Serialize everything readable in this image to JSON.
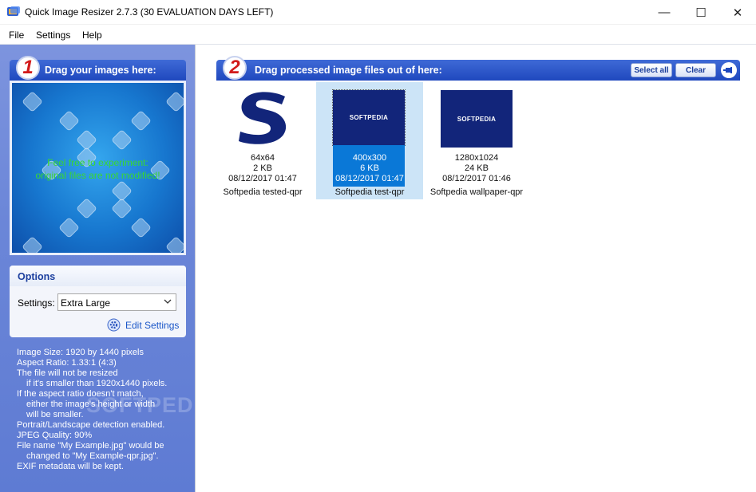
{
  "window": {
    "title": "Quick Image Resizer 2.7.3 (30 EVALUATION DAYS LEFT)",
    "minimize": "—",
    "maximize": "☐",
    "close": "✕"
  },
  "menu": [
    "File",
    "Settings",
    "Help"
  ],
  "left_panel": {
    "badge": "1",
    "header": "Drag your images here:",
    "drop_hint_line1": "Feel free to experiment:",
    "drop_hint_line2": "original files are not modified!"
  },
  "options": {
    "title": "Options",
    "settings_label": "Settings:",
    "settings_value": "Extra Large",
    "edit_settings": "Edit Settings"
  },
  "info_lines": [
    {
      "text": "Image Size: 1920 by 1440 pixels",
      "indent": false
    },
    {
      "text": "Aspect Ratio: 1.33:1 (4:3)",
      "indent": false
    },
    {
      "text": "The file will not be resized",
      "indent": false
    },
    {
      "text": "if it's smaller than 1920x1440 pixels.",
      "indent": true
    },
    {
      "text": "If the aspect ratio doesn't match,",
      "indent": false
    },
    {
      "text": "either the image's height or width",
      "indent": true
    },
    {
      "text": "will be smaller.",
      "indent": true
    },
    {
      "text": "Portrait/Landscape detection enabled.",
      "indent": false
    },
    {
      "text": "JPEG Quality: 90%",
      "indent": false
    },
    {
      "text": "File name \"My Example.jpg\" would be",
      "indent": false
    },
    {
      "text": "changed to \"My Example-qpr.jpg\".",
      "indent": true
    },
    {
      "text": "EXIF metadata will be kept.",
      "indent": false
    }
  ],
  "watermark": "SOFTPEDIA",
  "right_panel": {
    "badge": "2",
    "header": "Drag processed image files out of here:",
    "select_all": "Select all",
    "clear": "Clear"
  },
  "files": [
    {
      "dimensions": "64x64",
      "size": "2 KB",
      "date": "08/12/2017 01:47",
      "name": "Softpedia tested-qpr",
      "selected": false,
      "logo_text": "S"
    },
    {
      "dimensions": "400x300",
      "size": "6 KB",
      "date": "08/12/2017 01:47",
      "name": "Softpedia test-qpr",
      "selected": true,
      "logo_text": "SOFTPEDIA"
    },
    {
      "dimensions": "1280x1024",
      "size": "24 KB",
      "date": "08/12/2017 01:46",
      "name": "Softpedia wallpaper-qpr",
      "selected": false,
      "logo_text": "SOFTPEDIA"
    }
  ],
  "colors": {
    "header_blue": "#1f48be",
    "left_pane": "#6b86d8",
    "selection": "#cce4f7",
    "logo_navy": "#12257a",
    "drop_hint": "#39d733"
  }
}
